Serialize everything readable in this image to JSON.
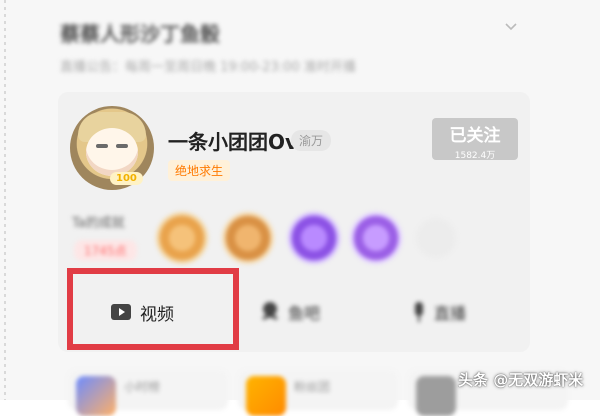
{
  "header": {
    "title": "蔡蔡人形沙丁鱼骰",
    "subtitle": "直播公告：每周一至周日晚 19:00-23:00 准时开播"
  },
  "profile": {
    "username": "一条小团团OvO",
    "level": "渝万",
    "avatar_badge": "100",
    "game_tag": "绝地求生",
    "follow_button": {
      "label": "已关注",
      "count": "1582.4万"
    }
  },
  "achievements": {
    "label": "Ta的成就",
    "points": "1745点"
  },
  "tabs": [
    {
      "label": "视频",
      "icon": "video-play-icon"
    },
    {
      "label": "鱼吧",
      "icon": "fish-icon"
    },
    {
      "label": "直播",
      "icon": "mic-icon"
    }
  ],
  "bottom_cards": [
    {
      "label": "小时榜"
    },
    {
      "label": "粉丝团"
    },
    {
      "label": ""
    }
  ],
  "watermark": "头条 @无双游虾米",
  "colors": {
    "highlight_box": "#e13c45",
    "game_tag_text": "#ff7a00",
    "points_text": "#ff6a6a"
  }
}
